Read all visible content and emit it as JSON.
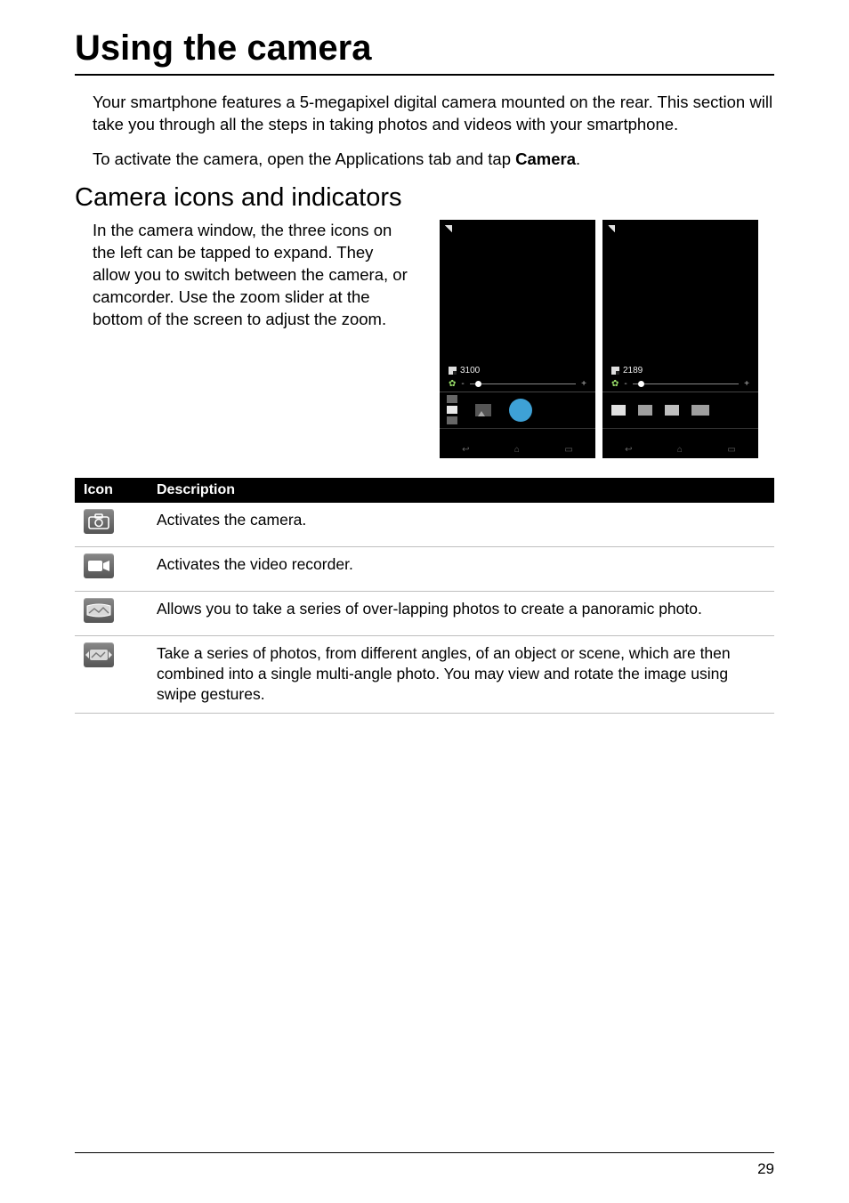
{
  "page": {
    "title": "Using the camera",
    "intro": "Your smartphone features a 5-megapixel digital camera mounted on the rear. This section will take you through all the steps in taking photos and videos with your smartphone.",
    "activate_prefix": "To activate the camera, open the Applications tab and tap ",
    "activate_bold": "Camera",
    "activate_suffix": ".",
    "section_title": "Camera icons and indicators",
    "section_body": "In the camera window, the three icons on the left can be tapped to expand. They allow you to switch between the camera, or camcorder. Use the zoom slider at the bottom of the screen to adjust the zoom.",
    "page_number": "29"
  },
  "screenshots": {
    "left": {
      "count": "3100",
      "layout": "stacked"
    },
    "right": {
      "count": "2189",
      "layout": "row"
    },
    "zoom": {
      "minus": "-",
      "plus": "+"
    },
    "nav": {
      "back": "↩",
      "home": "⌂",
      "recent": "▭"
    }
  },
  "table": {
    "headers": {
      "icon": "Icon",
      "description": "Description"
    },
    "rows": [
      {
        "icon": "camera-mode-icon",
        "desc": "Activates the camera."
      },
      {
        "icon": "video-mode-icon",
        "desc": "Activates the video recorder."
      },
      {
        "icon": "panorama-mode-icon",
        "desc": "Allows you to take a series of over-lapping photos to create a panoramic photo."
      },
      {
        "icon": "multi-angle-mode-icon",
        "desc": "Take a series of photos, from different angles, of an object or scene, which are then combined into a single multi-angle photo. You may view and rotate the image using swipe gestures."
      }
    ]
  }
}
